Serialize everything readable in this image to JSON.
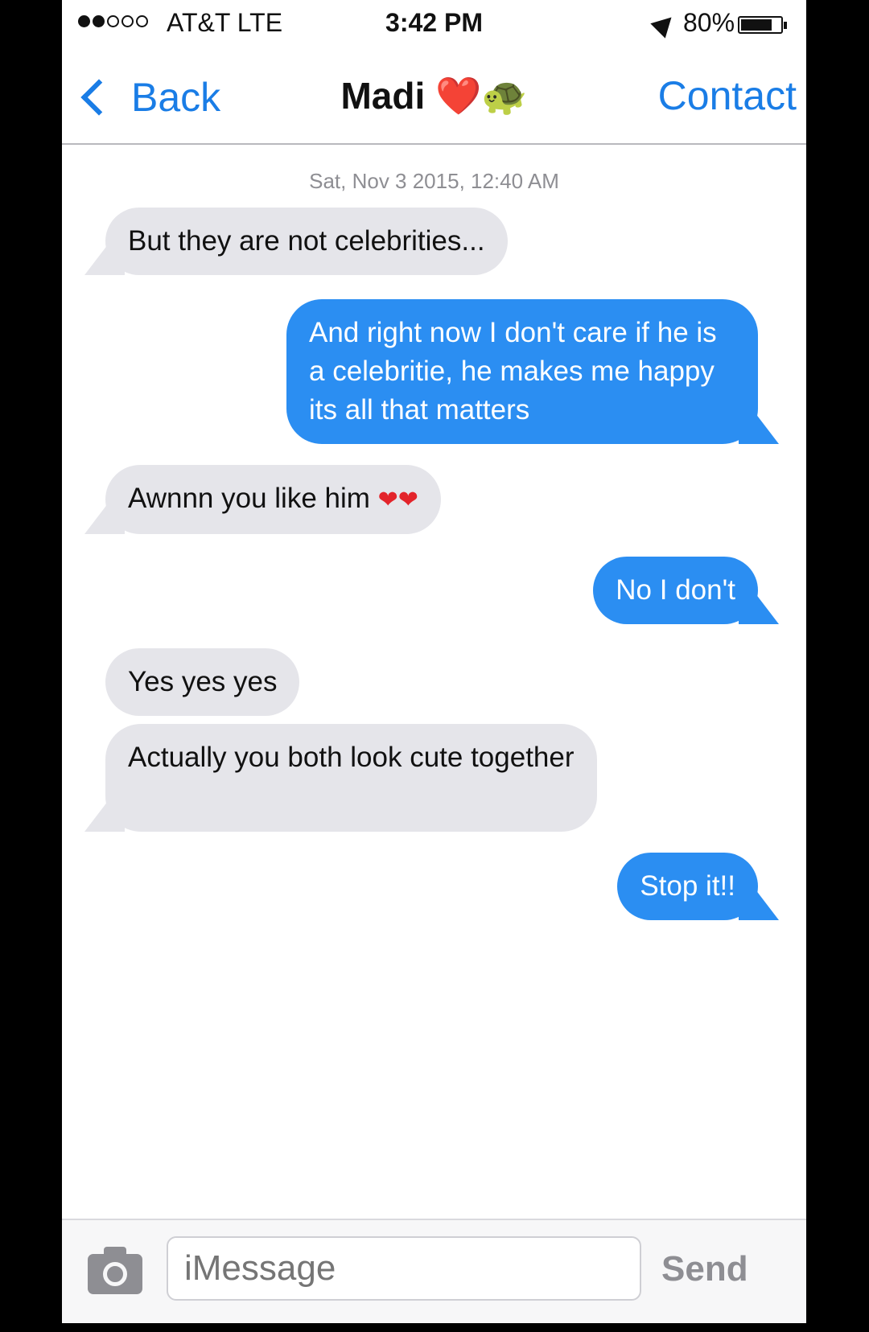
{
  "status_bar": {
    "carrier": "AT&T LTE",
    "signal_bars_filled": 2,
    "signal_bars_total": 5,
    "time": "3:42 PM",
    "battery_percent": "80%",
    "battery_level": 0.8
  },
  "nav": {
    "back_label": "Back",
    "title": "Madi",
    "title_emoji": "❤️🐢",
    "contact_label": "Contact"
  },
  "timestamp": "Sat, Nov 3 2015, 12:40 AM",
  "messages": [
    {
      "direction": "incoming",
      "text": "But they are not celebrities..."
    },
    {
      "direction": "outgoing",
      "text": "And right now I don't care if he is a celebritie, he makes me happy its all that matters"
    },
    {
      "direction": "incoming",
      "text": "Awnnn you like him",
      "emoji": "❤❤"
    },
    {
      "direction": "outgoing",
      "text": "No I don't"
    },
    {
      "direction": "incoming",
      "text": "Yes yes yes"
    },
    {
      "direction": "incoming",
      "text": "Actually you both look cute together"
    },
    {
      "direction": "outgoing",
      "text": "Stop it!!"
    }
  ],
  "input_bar": {
    "placeholder": "iMessage",
    "value": "",
    "send_label": "Send",
    "camera_icon": "camera-icon"
  },
  "colors": {
    "accent": "#1a7de6",
    "outgoing_bubble": "#2b8ef2",
    "incoming_bubble": "#e5e5ea"
  }
}
